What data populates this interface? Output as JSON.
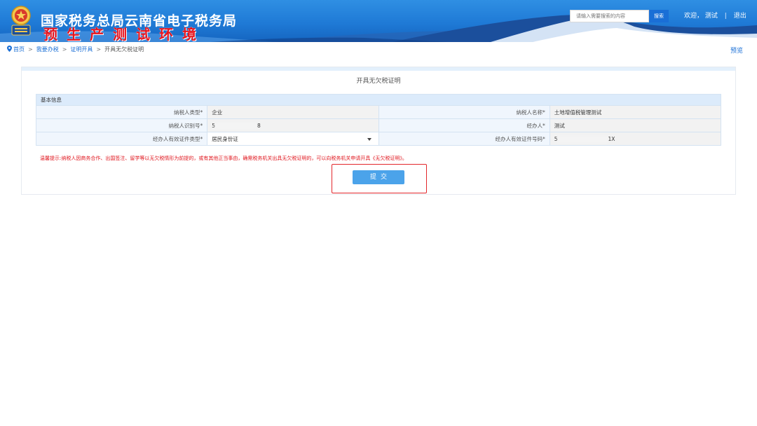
{
  "header": {
    "title": "国家税务总局云南省电子税务局",
    "subtitle": "预生产测试环境",
    "search_placeholder": "请输入需要搜索的内容",
    "search_button": "搜索",
    "welcome": "欢迎，",
    "username": "测试",
    "separator": "|",
    "logout": "退出"
  },
  "breadcrumb": {
    "items": [
      "首页",
      "我要办税",
      "证明开具",
      "开具无欠税证明"
    ],
    "separator": ">"
  },
  "preview_label": "预览",
  "form": {
    "title": "开具无欠税证明",
    "section_label": "基本信息",
    "rows": [
      {
        "left_label": "纳税人类型*",
        "left_value": "企业",
        "right_label": "纳税人名称*",
        "right_value": "土地增值税管理测试"
      },
      {
        "left_label": "纳税人识别号*",
        "left_value_prefix": "5",
        "left_value_suffix": "8",
        "right_label": "经办人*",
        "right_value": "测试"
      },
      {
        "left_label": "经办人有效证件类型*",
        "left_value": "居民身份证",
        "right_label": "经办人有效证件号码*",
        "right_value_prefix": "5",
        "right_value_suffix": "1X"
      }
    ],
    "tip": "温馨提示:纳税人因商务合作、出国签注、留学等以无欠税情形为前提的，或有其他正当事由，确需税务机关出具无欠税证明的，可以向税务机关申请开具《无欠税证明》。",
    "submit_label": "提交"
  },
  "colors": {
    "header_blue": "#1f7ad6",
    "subtitle_red": "#e6141e",
    "link_blue": "#1a6fd6",
    "submit_blue": "#4ba3ea",
    "highlight_red": "#e3262b"
  }
}
